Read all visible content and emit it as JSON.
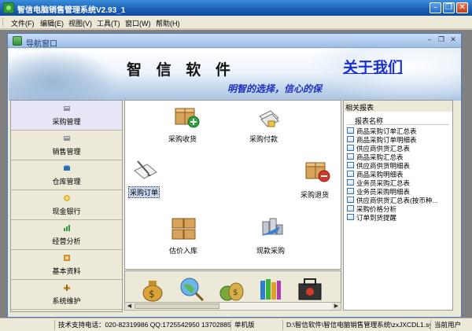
{
  "window": {
    "title": "智信电脑销售管理系统V2.93_1"
  },
  "menu": {
    "items": [
      "文件(F)",
      "编辑(E)",
      "视图(V)",
      "工具(T)",
      "窗口(W)",
      "帮助(H)"
    ]
  },
  "child_window": {
    "title": "导航窗口"
  },
  "banner": {
    "brand": "智 信 软 件",
    "about": "关于我们",
    "slogan": "明智的选择，信心的保"
  },
  "nav": {
    "items": [
      {
        "label": "采购管理",
        "active": true,
        "icon": "cart-icon"
      },
      {
        "label": "销售管理",
        "active": false,
        "icon": "sales-icon"
      },
      {
        "label": "仓库管理",
        "active": false,
        "icon": "warehouse-icon"
      },
      {
        "label": "现金银行",
        "active": false,
        "icon": "bank-icon"
      },
      {
        "label": "经营分析",
        "active": false,
        "icon": "analysis-icon"
      },
      {
        "label": "基本资料",
        "active": false,
        "icon": "data-icon"
      },
      {
        "label": "系统维护",
        "active": false,
        "icon": "maintenance-icon"
      }
    ]
  },
  "workspace": {
    "tiles": [
      {
        "label": "采购收货",
        "icon": "box-add-icon"
      },
      {
        "label": "采购付款",
        "icon": "payment-icon"
      },
      {
        "label": "采购订单",
        "icon": "order-icon",
        "selected": true
      },
      {
        "label": "采购退货",
        "icon": "box-return-icon"
      },
      {
        "label": "估价入库",
        "icon": "stock-in-icon"
      },
      {
        "label": "现款采购",
        "icon": "cash-purchase-icon"
      }
    ]
  },
  "reports": {
    "panel_title": "相关报表",
    "column_header": "报表名称",
    "items": [
      "商品采购订单汇总表",
      "商品采购订单明细表",
      "供应商供货汇总表",
      "商品采购汇总表",
      "供应商供货明细表",
      "商品采购明细表",
      "业务员采购汇总表",
      "业务员采购明细表",
      "供应商供货汇总表(按币种...",
      "采购价格分析",
      "订单到货提醒"
    ]
  },
  "status": {
    "support": "技术支持电话：020-82319986 QQ:1725542950 137028856",
    "mode": "单机版",
    "path": "D:\\智信软件\\智信电脑销售管理系统\\zxJXCDL1.sys",
    "user": "当前用户"
  },
  "colors": {
    "titlebar": "#1c5fb5",
    "about_link": "#1a2fd0",
    "slogan": "#2030c0",
    "active_nav": "#e6e6f7"
  }
}
